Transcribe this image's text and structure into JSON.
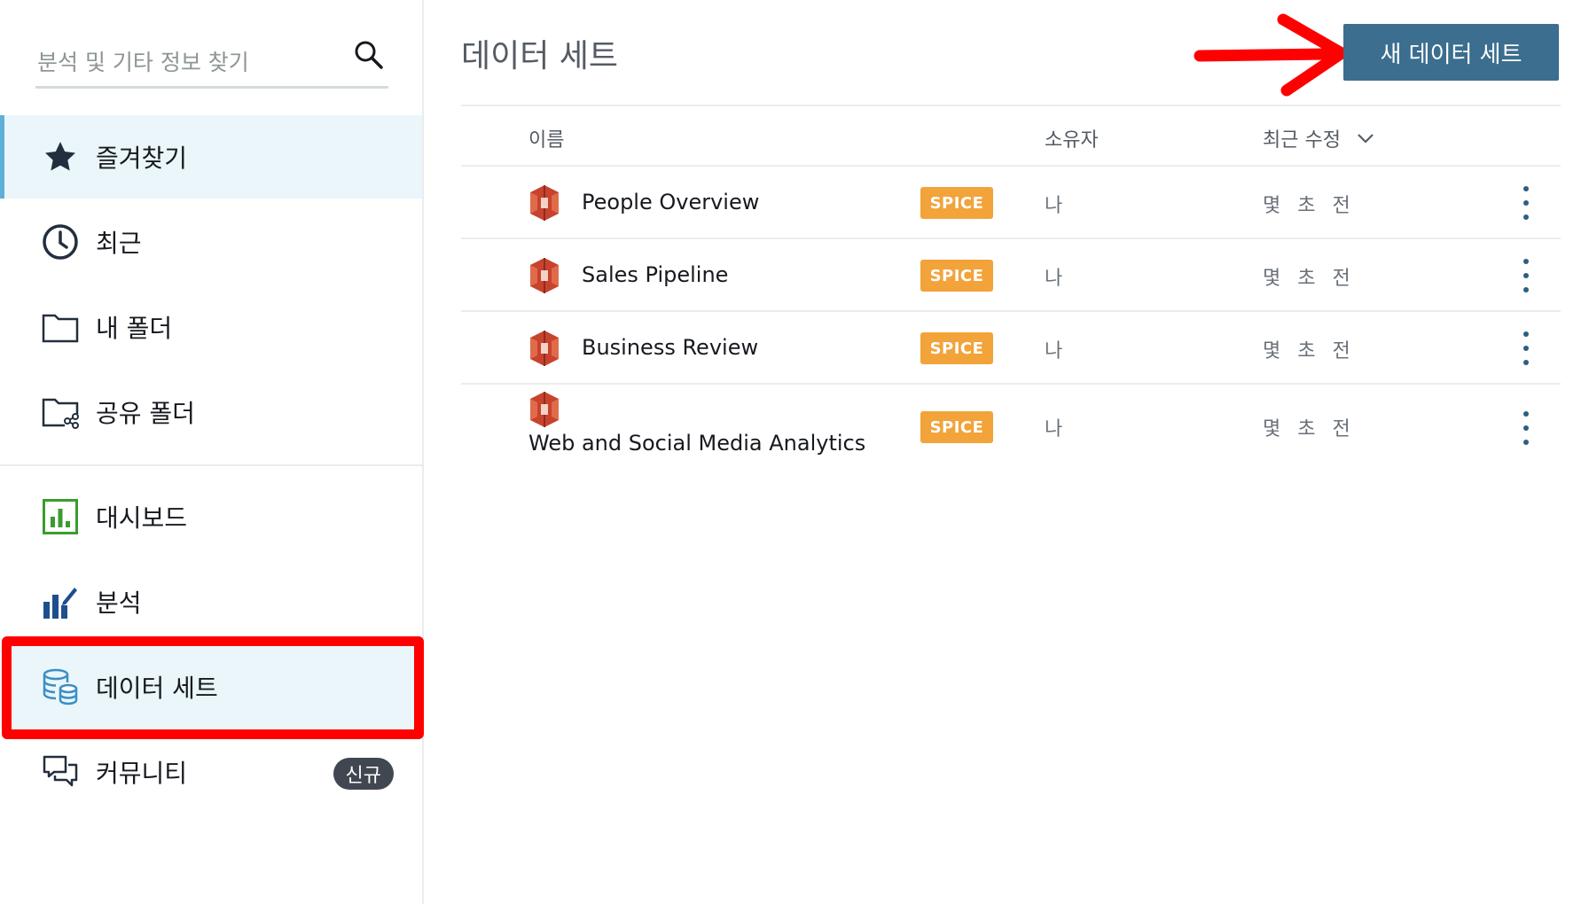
{
  "search": {
    "placeholder": "분석 및 기타 정보 찾기"
  },
  "sidebar": {
    "items": [
      {
        "label": "즐겨찾기",
        "icon": "star-icon"
      },
      {
        "label": "최근",
        "icon": "clock-icon"
      },
      {
        "label": "내 폴더",
        "icon": "folder-icon"
      },
      {
        "label": "공유 폴더",
        "icon": "shared-folder-icon"
      },
      {
        "label": "대시보드",
        "icon": "dashboard-icon"
      },
      {
        "label": "분석",
        "icon": "analysis-icon"
      },
      {
        "label": "데이터 세트",
        "icon": "dataset-icon"
      },
      {
        "label": "커뮤니티",
        "icon": "community-icon",
        "badge": "신규"
      }
    ]
  },
  "main": {
    "title": "데이터 세트",
    "new_button_label": "새 데이터 세트",
    "columns": {
      "name": "이름",
      "owner": "소유자",
      "modified": "최근 수정"
    },
    "rows": [
      {
        "name": "People Overview",
        "tag": "SPICE",
        "owner": "나",
        "modified": "몇 초 전"
      },
      {
        "name": "Sales Pipeline",
        "tag": "SPICE",
        "owner": "나",
        "modified": "몇 초 전"
      },
      {
        "name": "Business Review",
        "tag": "SPICE",
        "owner": "나",
        "modified": "몇 초 전"
      },
      {
        "name": "Web and Social Media Analytics",
        "tag": "SPICE",
        "owner": "나",
        "modified": "몇 초 전"
      }
    ]
  },
  "colors": {
    "primary_button": "#3b6e8f",
    "spice_badge": "#f2a33a",
    "selected_bg": "#eaf6f9",
    "annotation_red": "#ff0000",
    "dataset_icon": "#c7432e"
  }
}
